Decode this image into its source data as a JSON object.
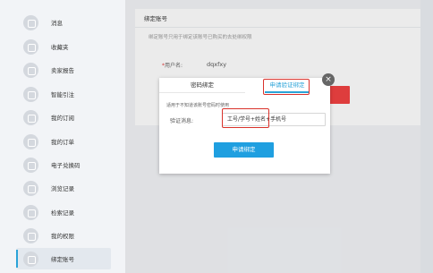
{
  "sidebar": {
    "items": [
      {
        "label": "消息",
        "icon": "message-icon"
      },
      {
        "label": "收藏夹",
        "icon": "favorites-icon"
      },
      {
        "label": "卖家报告",
        "icon": "report-icon"
      },
      {
        "label": "智能引注",
        "icon": "citation-icon"
      },
      {
        "label": "我的订阅",
        "icon": "subscription-icon"
      },
      {
        "label": "我的订单",
        "icon": "order-icon"
      },
      {
        "label": "电子兑换码",
        "icon": "redeem-code-icon"
      },
      {
        "label": "浏览记录",
        "icon": "history-icon"
      },
      {
        "label": "检索记录",
        "icon": "search-history-icon"
      },
      {
        "label": "我的权限",
        "icon": "permission-icon"
      },
      {
        "label": "绑定账号",
        "icon": "link-account-icon",
        "active": true
      }
    ]
  },
  "panel": {
    "title": "绑定账号",
    "hint": "绑定账号只用于绑定该账号已购买的去处绑权限",
    "username_label": "用户名:",
    "username_required": "*",
    "username_value": "dqxfxy"
  },
  "dialog": {
    "close": "×",
    "tab_password": "密码绑定",
    "tab_apply": "申请验证绑定",
    "hint": "适用于不知道该账号密码时使用",
    "verify_label": "验证消息:",
    "verify_value": "工号/学号+姓名+手机号",
    "submit": "申请绑定"
  },
  "colors": {
    "accent": "#2aa3d8",
    "button": "#1f9fe0",
    "highlight": "#d9322b"
  }
}
